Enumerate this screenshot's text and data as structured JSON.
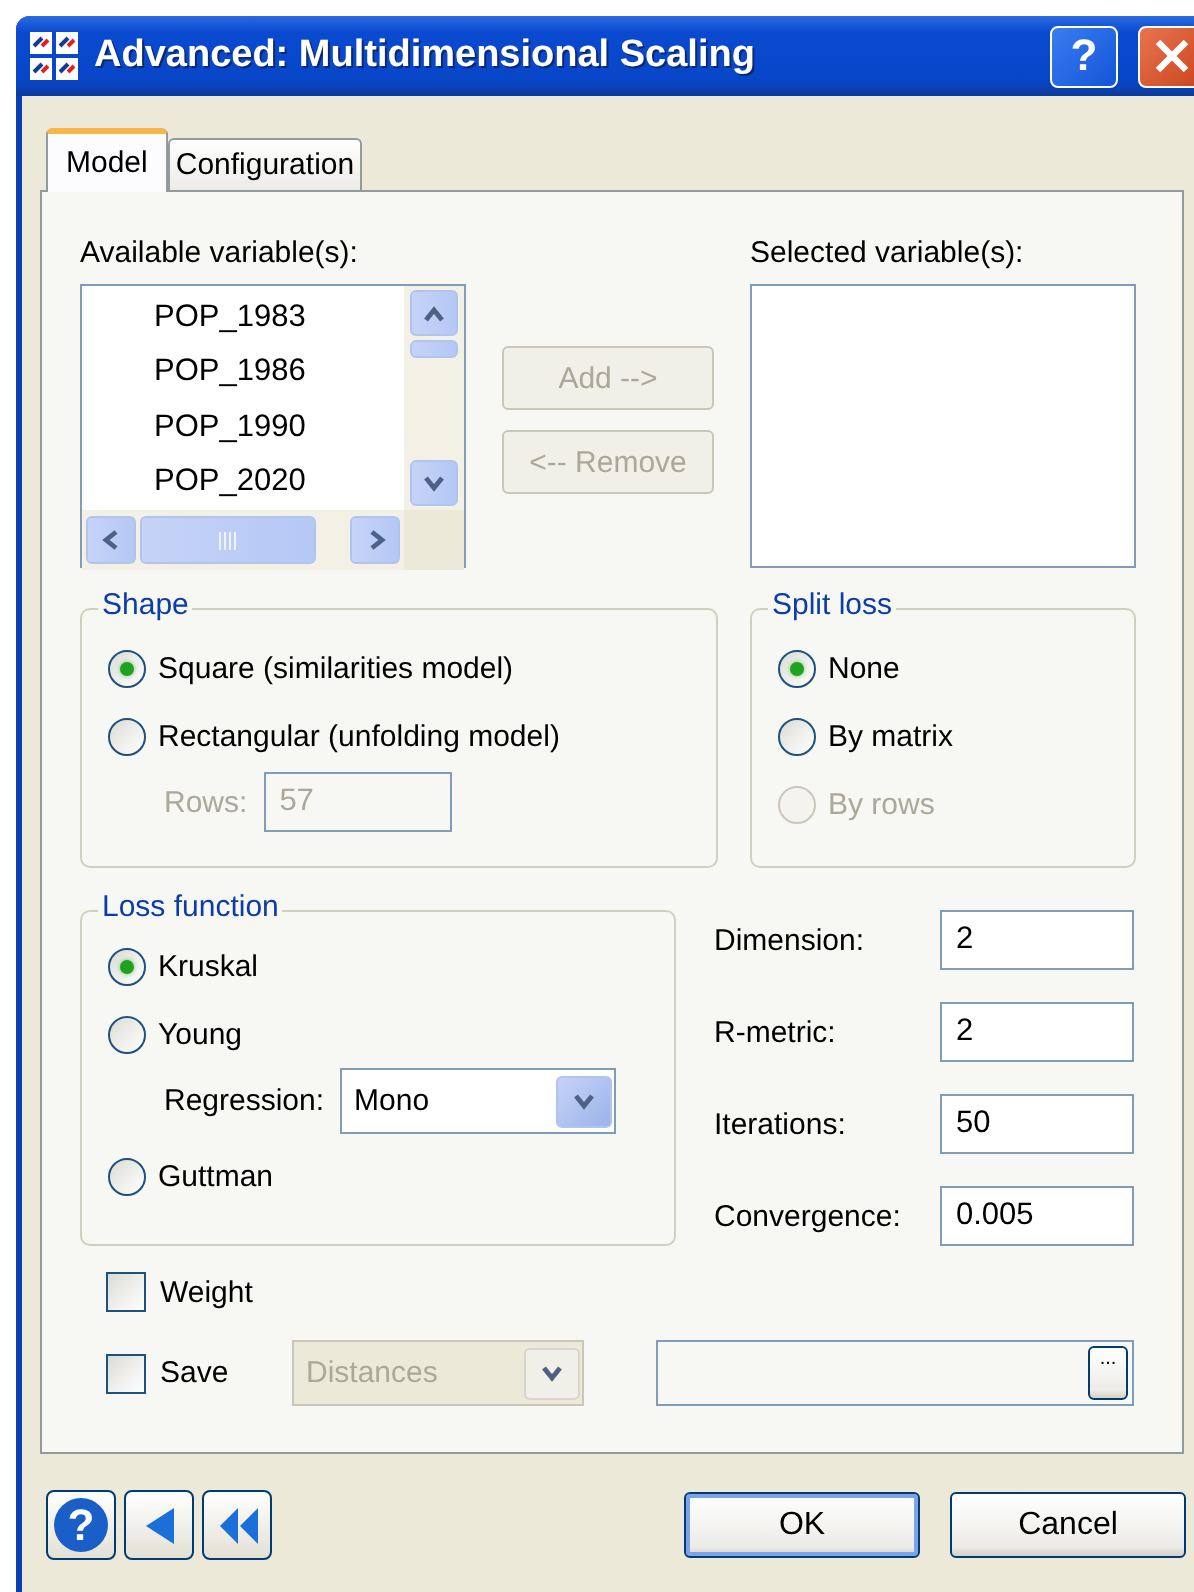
{
  "window": {
    "title": "Advanced: Multidimensional Scaling",
    "help_button": "?"
  },
  "tabs": [
    {
      "label": "Model",
      "selected": true
    },
    {
      "label": "Configuration",
      "selected": false
    }
  ],
  "available": {
    "label": "Available variable(s):",
    "items": [
      "POP_1983",
      "POP_1986",
      "POP_1990",
      "POP_2020"
    ]
  },
  "selected_variables": {
    "label": "Selected variable(s):"
  },
  "move_buttons": [
    {
      "label": "Add -->",
      "disabled": true
    },
    {
      "label": "<-- Remove",
      "disabled": true
    }
  ],
  "shape": {
    "title": "Shape",
    "options": [
      {
        "kind": "radio",
        "label": "Square (similarities model)",
        "selected": true,
        "disabled": false
      },
      {
        "kind": "radio",
        "label": "Rectangular (unfolding model)",
        "selected": false,
        "disabled": false
      },
      {
        "kind": "field",
        "label": "Rows:",
        "value": "57",
        "disabled": true
      }
    ]
  },
  "split_loss": {
    "title": "Split loss",
    "options": [
      {
        "kind": "radio",
        "label": "None",
        "selected": true,
        "disabled": false
      },
      {
        "kind": "radio",
        "label": "By matrix",
        "selected": false,
        "disabled": false
      },
      {
        "kind": "radio",
        "label": "By rows",
        "selected": false,
        "disabled": true
      }
    ]
  },
  "loss_function": {
    "title": "Loss function",
    "options": [
      {
        "kind": "radio",
        "label": "Kruskal",
        "selected": true,
        "disabled": false
      },
      {
        "kind": "radio",
        "label": "Young",
        "selected": false,
        "disabled": false
      },
      {
        "kind": "combo",
        "label": "Regression:",
        "value": "Mono",
        "disabled": false
      },
      {
        "kind": "radio",
        "label": "Guttman",
        "selected": false,
        "disabled": false
      }
    ]
  },
  "parameters": [
    {
      "label": "Dimension:",
      "value": "2"
    },
    {
      "label": "R-metric:",
      "value": "2"
    },
    {
      "label": "Iterations:",
      "value": "50"
    },
    {
      "label": "Convergence:",
      "value": "0.005"
    }
  ],
  "weight": {
    "label": "Weight",
    "checked": false
  },
  "save": {
    "label": "Save",
    "checked": false,
    "combo": {
      "value": "Distances",
      "disabled": true
    },
    "browse_button": "..."
  },
  "footer": {
    "help_button": "?",
    "buttons": [
      {
        "label": "OK",
        "default": true
      },
      {
        "label": "Cancel",
        "default": false
      }
    ]
  }
}
